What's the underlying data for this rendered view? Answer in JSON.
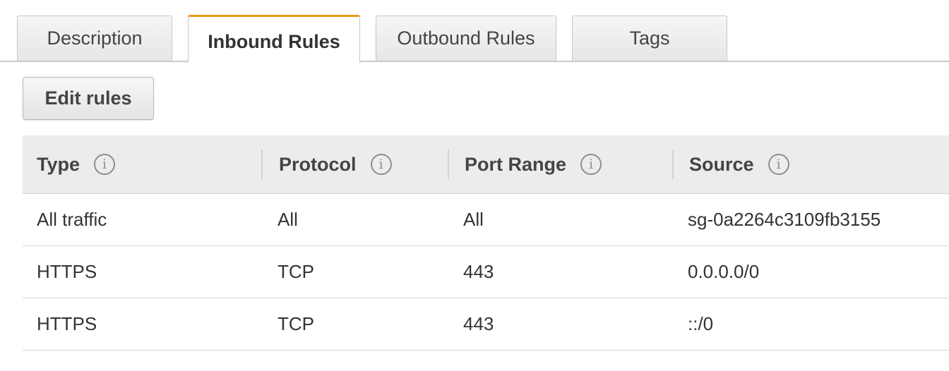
{
  "tabs": [
    {
      "label": "Description",
      "active": false
    },
    {
      "label": "Inbound Rules",
      "active": true
    },
    {
      "label": "Outbound Rules",
      "active": false
    },
    {
      "label": "Tags",
      "active": false
    }
  ],
  "toolbar": {
    "edit_rules_label": "Edit rules"
  },
  "table": {
    "columns": [
      {
        "label": "Type",
        "icon": "info-icon"
      },
      {
        "label": "Protocol",
        "icon": "info-icon"
      },
      {
        "label": "Port Range",
        "icon": "info-icon"
      },
      {
        "label": "Source",
        "icon": "info-icon"
      }
    ],
    "info_glyph": "i",
    "rows": [
      {
        "type": "All traffic",
        "protocol": "All",
        "port_range": "All",
        "source": "sg-0a2264c3109fb3155"
      },
      {
        "type": "HTTPS",
        "protocol": "TCP",
        "port_range": "443",
        "source": "0.0.0.0/0"
      },
      {
        "type": "HTTPS",
        "protocol": "TCP",
        "port_range": "443",
        "source": "::/0"
      }
    ]
  },
  "colors": {
    "active_tab_accent": "#ec9a1b",
    "header_background": "#ececec"
  }
}
